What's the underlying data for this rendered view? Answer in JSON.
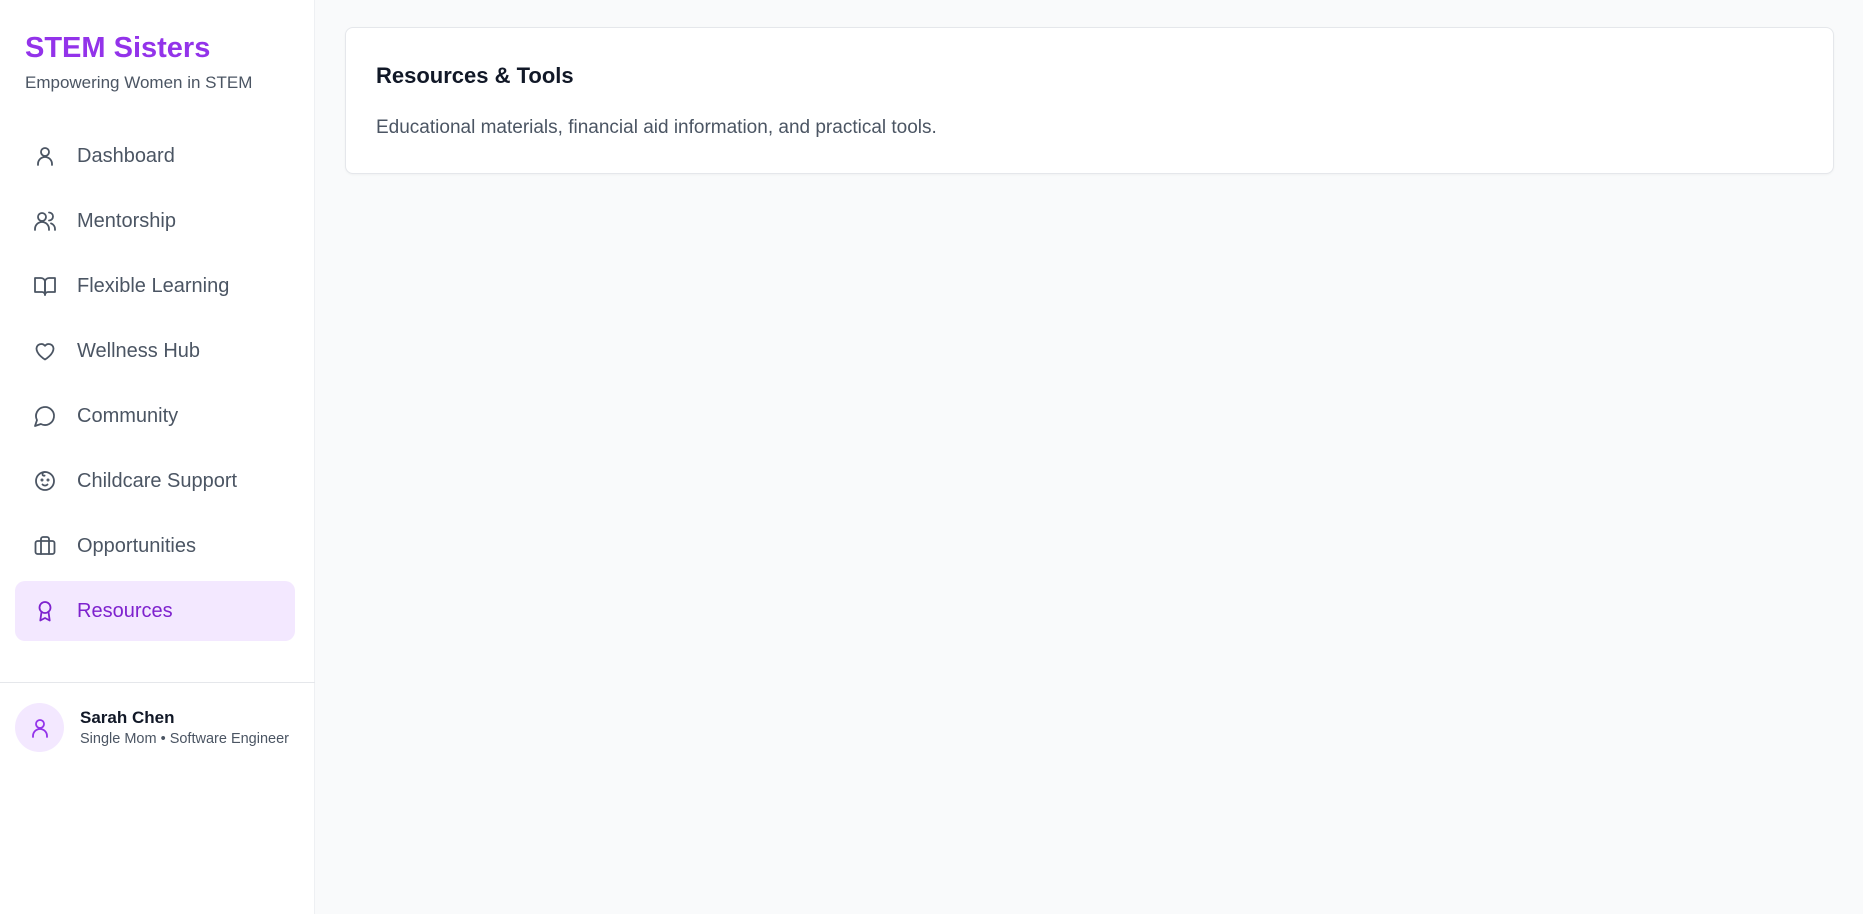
{
  "brand": {
    "title": "STEM Sisters",
    "subtitle": "Empowering Women in STEM",
    "accent_color": "#9333ea"
  },
  "sidebar": {
    "items": [
      {
        "label": "Dashboard",
        "icon": "user-icon",
        "active": false
      },
      {
        "label": "Mentorship",
        "icon": "users-icon",
        "active": false
      },
      {
        "label": "Flexible Learning",
        "icon": "book-open-icon",
        "active": false
      },
      {
        "label": "Wellness Hub",
        "icon": "heart-icon",
        "active": false
      },
      {
        "label": "Community",
        "icon": "message-circle-icon",
        "active": false
      },
      {
        "label": "Childcare Support",
        "icon": "baby-icon",
        "active": false
      },
      {
        "label": "Opportunities",
        "icon": "briefcase-icon",
        "active": false
      },
      {
        "label": "Resources",
        "icon": "award-icon",
        "active": true
      }
    ],
    "active_bg_color": "#f3e8ff",
    "active_text_color": "#7e22ce"
  },
  "user": {
    "name": "Sarah Chen",
    "role": "Single Mom • Software Engineer",
    "avatar_icon": "user-icon"
  },
  "main": {
    "card": {
      "title": "Resources & Tools",
      "description": "Educational materials, financial aid information, and practical tools."
    }
  }
}
